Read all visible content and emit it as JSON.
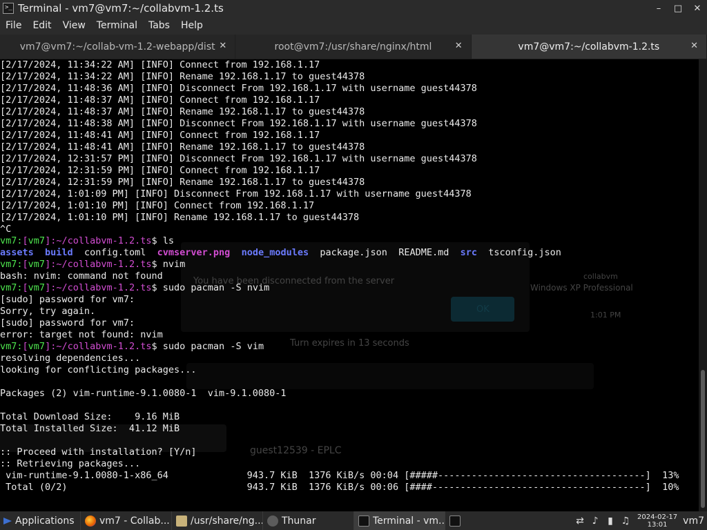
{
  "window": {
    "title": "Terminal - vm7@vm7:~/collabvm-1.2.ts",
    "app_icon_glyph": ">_",
    "minimize_glyph": "–",
    "maximize_glyph": "□",
    "close_glyph": "✕"
  },
  "menu": [
    "File",
    "Edit",
    "View",
    "Terminal",
    "Tabs",
    "Help"
  ],
  "tabs": [
    {
      "label": "vm7@vm7:~/collab-vm-1.2-webapp/dist",
      "close": "✕"
    },
    {
      "label": "root@vm7:/usr/share/nginx/html",
      "close": "✕"
    },
    {
      "label": "vm7@vm7:~/collabvm-1.2.ts",
      "close": "✕"
    }
  ],
  "terminal": {
    "log": [
      "[2/17/2024, 11:34:22 AM] [INFO] Connect from 192.168.1.17",
      "[2/17/2024, 11:34:22 AM] [INFO] Rename 192.168.1.17 to guest44378",
      "[2/17/2024, 11:48:36 AM] [INFO] Disconnect From 192.168.1.17 with username guest44378",
      "[2/17/2024, 11:48:37 AM] [INFO] Connect from 192.168.1.17",
      "[2/17/2024, 11:48:37 AM] [INFO] Rename 192.168.1.17 to guest44378",
      "[2/17/2024, 11:48:38 AM] [INFO] Disconnect From 192.168.1.17 with username guest44378",
      "[2/17/2024, 11:48:41 AM] [INFO] Connect from 192.168.1.17",
      "[2/17/2024, 11:48:41 AM] [INFO] Rename 192.168.1.17 to guest44378",
      "[2/17/2024, 12:31:57 PM] [INFO] Disconnect From 192.168.1.17 with username guest44378",
      "[2/17/2024, 12:31:59 PM] [INFO] Connect from 192.168.1.17",
      "[2/17/2024, 12:31:59 PM] [INFO] Rename 192.168.1.17 to guest44378",
      "[2/17/2024, 1:01:09 PM] [INFO] Disconnect From 192.168.1.17 with username guest44378",
      "[2/17/2024, 1:01:10 PM] [INFO] Connect from 192.168.1.17",
      "[2/17/2024, 1:01:10 PM] [INFO] Rename 192.168.1.17 to guest44378",
      "^C"
    ],
    "prompt": {
      "user": "vm7",
      "colon": ":",
      "lb": "[",
      "host": "vm7",
      "rb": "]",
      "path": ":~/collabvm-1.2.ts",
      "sym": "$"
    },
    "cmd_ls": " ls",
    "ls_items": [
      {
        "name": "assets",
        "type": "dir"
      },
      {
        "name": "build",
        "type": "dir"
      },
      {
        "name": "config.toml",
        "type": "file"
      },
      {
        "name": "cvmserver.png",
        "type": "image"
      },
      {
        "name": "node_modules",
        "type": "dir"
      },
      {
        "name": "package.json",
        "type": "file"
      },
      {
        "name": "README.md",
        "type": "file"
      },
      {
        "name": "src",
        "type": "dir"
      },
      {
        "name": "tsconfig.json",
        "type": "file"
      }
    ],
    "cmd_nvim": " nvim",
    "out_nvim": "bash: nvim: command not found",
    "cmd_pacman_nvim": " sudo pacman -S nvim",
    "out_pacman_nvim": [
      "[sudo] password for vm7:",
      "Sorry, try again.",
      "[sudo] password for vm7:",
      "error: target not found: nvim"
    ],
    "cmd_pacman_vim": " sudo pacman -S vim",
    "out_pacman_vim": [
      "resolving dependencies...",
      "looking for conflicting packages...",
      "",
      "Packages (2) vim-runtime-9.1.0080-1  vim-9.1.0080-1",
      "",
      "Total Download Size:    9.16 MiB",
      "Total Installed Size:  41.12 MiB",
      "",
      ":: Proceed with installation? [Y/n]",
      ":: Retrieving packages..."
    ],
    "downloads": [
      {
        "line": " vim-runtime-9.1.0080-1-x86_64              943.7 KiB  1376 KiB/s 00:04 [#####-------------------------------------]  13%",
        "percent": 13
      },
      {
        "line": " Total (0/2)                                943.7 KiB  1376 KiB/s 00:06 [####--------------------------------------]  10%",
        "percent": 10
      }
    ]
  },
  "background_ghost": {
    "disconnected": "You have been disconnected from the server",
    "ok": "OK",
    "turn": "Turn expires in 13 seconds",
    "user1": "guest12539 - EPLC",
    "winxp": "Windows XP Professional",
    "cvm": "collabvm",
    "time": "1:01 PM"
  },
  "taskbar": {
    "applications": "Applications",
    "windows": [
      {
        "label": "vm7 - Collab...",
        "icon": "firefox-icon",
        "active": false
      },
      {
        "label": "/usr/share/ng...",
        "icon": "text-editor-icon",
        "active": false
      },
      {
        "label": "Thunar",
        "icon": "file-manager-icon",
        "active": false
      },
      {
        "label": "Terminal - vm...",
        "icon": "terminal-icon",
        "active": true
      }
    ],
    "clock_date": "2024-02-17",
    "clock_time": "13:01",
    "user": "vm7"
  },
  "colors": {
    "prompt_green": "#4ee64e",
    "prompt_magenta": "#d24dd2",
    "dir_blue": "#6b7bff",
    "image_magenta": "#d24dd2",
    "terminal_bg": "#000000"
  }
}
